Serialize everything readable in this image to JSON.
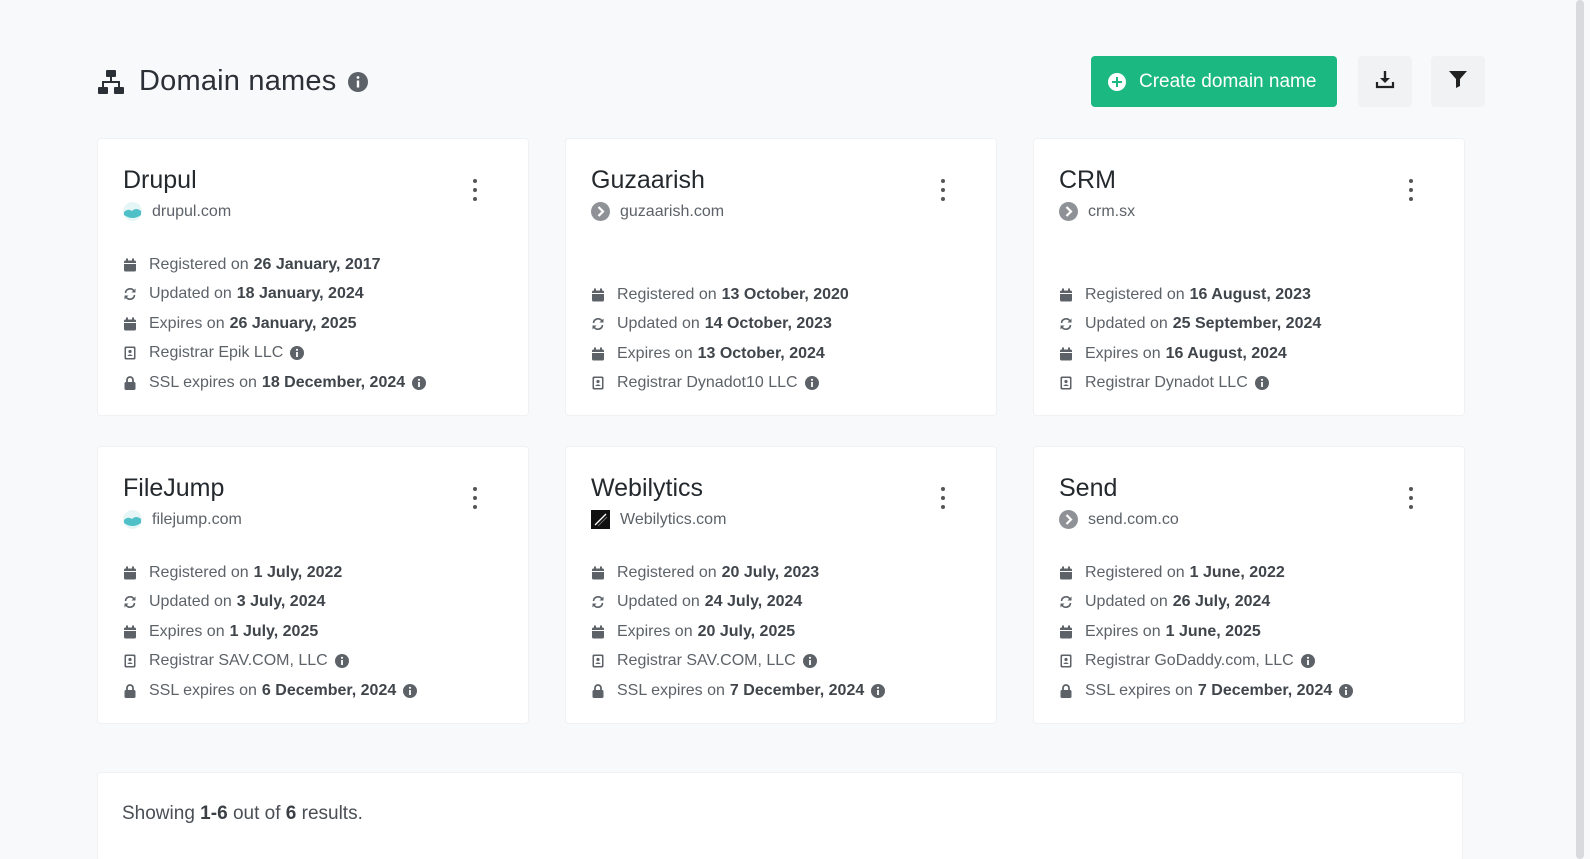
{
  "header": {
    "title": "Domain names",
    "title_icon": "sitemap-icon",
    "create_label": "Create domain name",
    "accent": "#1cb882"
  },
  "cards": [
    {
      "name": "Drupul",
      "domain": "drupul.com",
      "favicon": "cloud-favicon",
      "rows": [
        {
          "icon": "calendar-icon",
          "label": "Registered on",
          "value": "26 January, 2017"
        },
        {
          "icon": "refresh-icon",
          "label": "Updated on",
          "value": "18 January, 2024"
        },
        {
          "icon": "calendar-icon",
          "label": "Expires on",
          "value": "26 January, 2025"
        },
        {
          "icon": "address-book-icon",
          "label": "Registrar Epik LLC",
          "value": ""
        },
        {
          "icon": "lock-icon",
          "label": "SSL expires on",
          "value": "18 December, 2024"
        }
      ]
    },
    {
      "name": "Guzaarish",
      "domain": "guzaarish.com",
      "favicon": "chevron-circle-favicon",
      "rows": [
        {
          "icon": "calendar-icon",
          "label": "Registered on",
          "value": "13 October, 2020"
        },
        {
          "icon": "refresh-icon",
          "label": "Updated on",
          "value": "14 October, 2023"
        },
        {
          "icon": "calendar-icon",
          "label": "Expires on",
          "value": "13 October, 2024"
        },
        {
          "icon": "address-book-icon",
          "label": "Registrar Dynadot10 LLC",
          "value": ""
        }
      ]
    },
    {
      "name": "CRM",
      "domain": "crm.sx",
      "favicon": "chevron-circle-favicon",
      "rows": [
        {
          "icon": "calendar-icon",
          "label": "Registered on",
          "value": "16 August, 2023"
        },
        {
          "icon": "refresh-icon",
          "label": "Updated on",
          "value": "25 September, 2024"
        },
        {
          "icon": "calendar-icon",
          "label": "Expires on",
          "value": "16 August, 2024"
        },
        {
          "icon": "address-book-icon",
          "label": "Registrar Dynadot LLC",
          "value": ""
        }
      ]
    },
    {
      "name": "FileJump",
      "domain": "filejump.com",
      "favicon": "cloud-favicon",
      "rows": [
        {
          "icon": "calendar-icon",
          "label": "Registered on",
          "value": "1 July, 2022"
        },
        {
          "icon": "refresh-icon",
          "label": "Updated on",
          "value": "3 July, 2024"
        },
        {
          "icon": "calendar-icon",
          "label": "Expires on",
          "value": "1 July, 2025"
        },
        {
          "icon": "address-book-icon",
          "label": "Registrar SAV.COM, LLC",
          "value": ""
        },
        {
          "icon": "lock-icon",
          "label": "SSL expires on",
          "value": "6 December, 2024"
        }
      ]
    },
    {
      "name": "Webilytics",
      "domain": "Webilytics.com",
      "favicon": "slash-square-favicon",
      "rows": [
        {
          "icon": "calendar-icon",
          "label": "Registered on",
          "value": "20 July, 2023"
        },
        {
          "icon": "refresh-icon",
          "label": "Updated on",
          "value": "24 July, 2024"
        },
        {
          "icon": "calendar-icon",
          "label": "Expires on",
          "value": "20 July, 2025"
        },
        {
          "icon": "address-book-icon",
          "label": "Registrar SAV.COM, LLC",
          "value": ""
        },
        {
          "icon": "lock-icon",
          "label": "SSL expires on",
          "value": "7 December, 2024"
        }
      ]
    },
    {
      "name": "Send",
      "domain": "send.com.co",
      "favicon": "chevron-circle-favicon",
      "rows": [
        {
          "icon": "calendar-icon",
          "label": "Registered on",
          "value": "1 June, 2022"
        },
        {
          "icon": "refresh-icon",
          "label": "Updated on",
          "value": "26 July, 2024"
        },
        {
          "icon": "calendar-icon",
          "label": "Expires on",
          "value": "1 June, 2025"
        },
        {
          "icon": "address-book-icon",
          "label": "Registrar GoDaddy.com, LLC",
          "value": ""
        },
        {
          "icon": "lock-icon",
          "label": "SSL expires on",
          "value": "7 December, 2024"
        }
      ]
    }
  ],
  "footer": {
    "prefix": "Showing",
    "range_start": "1",
    "range_sep": "-",
    "range_end": "6",
    "mid": "out of",
    "total": "6",
    "suffix": "results."
  }
}
